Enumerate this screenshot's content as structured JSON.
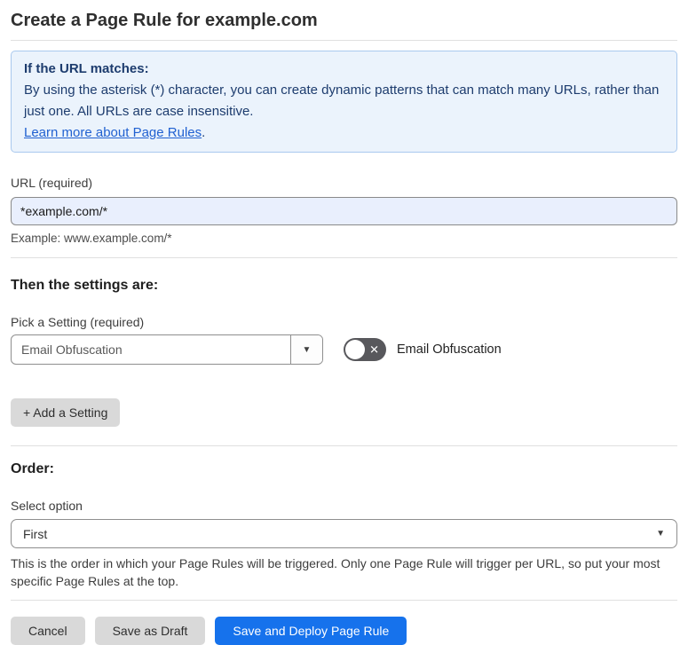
{
  "header": {
    "title": "Create a Page Rule for example.com"
  },
  "info_box": {
    "heading": "If the URL matches:",
    "body": "By using the asterisk (*) character, you can create dynamic patterns that can match many URLs, rather than just one. All URLs are case insensitive.",
    "link_label": "Learn more about Page Rules",
    "link_suffix": "."
  },
  "url_section": {
    "label": "URL (required)",
    "value": "*example.com/*",
    "example": "Example: www.example.com/*"
  },
  "settings_section": {
    "heading": "Then the settings are:",
    "pick_label": "Pick a Setting (required)",
    "selected_setting": "Email Obfuscation",
    "toggle_label": "Email Obfuscation",
    "toggle_state": "off",
    "add_button_label": "+ Add a Setting"
  },
  "order_section": {
    "heading": "Order:",
    "select_label": "Select option",
    "selected_option": "First",
    "help_text": "This is the order in which your Page Rules will be triggered. Only one Page Rule will trigger per URL, so put your most specific Page Rules at the top."
  },
  "footer": {
    "cancel_label": "Cancel",
    "save_draft_label": "Save as Draft",
    "save_deploy_label": "Save and Deploy Page Rule"
  },
  "icons": {
    "dropdown_arrow": "▼",
    "select_arrow": "▼",
    "toggle_x": "✕"
  },
  "colors": {
    "info_box_bg": "#ebf3fc",
    "info_box_border": "#a9c9ee",
    "info_text": "#1d3c6e",
    "link_blue": "#2161d1",
    "input_bg": "#e9effd",
    "primary_button_blue": "#1672ec",
    "gray_button_bg": "#d9d9d9",
    "toggle_off_bg": "#58585c"
  }
}
